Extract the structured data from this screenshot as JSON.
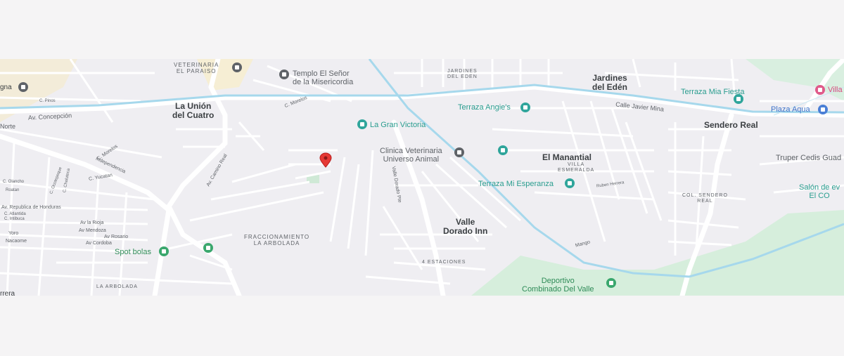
{
  "map": {
    "places": {
      "la_union": "La Unión\ndel Cuatro",
      "jardines": "Jardines\ndel Edén",
      "sendero": "Sendero Real",
      "manantial": "El Manantial",
      "valle": "Valle\nDorado Inn"
    },
    "neighborhoods": {
      "veterinaria_paraiso": "VETERINARIA\nEL PARAISO",
      "jardines_small": "JARDINES\nDEL EDEN",
      "villa_esmeralda": "VILLA\nESMERALDA",
      "col_sendero": "COL. SENDERO\nREAL",
      "fraccionamiento": "FRACCIONAMIENTO\nLA ARBOLADA",
      "cuatro_estaciones": "4 ESTACIONES",
      "la_arbolada": "LA ARBOLADA"
    },
    "streets": {
      "av_concepcion": "Av. Concepción",
      "norte": "Norte",
      "calle_javier_mina": "Calle Javier Mina",
      "c_morelos": "C. Morelos",
      "c_morelos2": "C. Morelos",
      "independencia": "Independencia",
      "av_camino_real": "Av. Camino Real",
      "c_yucatan": "C. Yucatan",
      "av_republica": "Av. Republica de Honduras",
      "av_la_rioja": "Av la Rioja",
      "av_mendoza": "Av Mendoza",
      "av_rosario": "Av Rosario",
      "av_cordoba": "Av Cordoba",
      "yoro": "Yoro",
      "nacaome": "Nacaome",
      "c_intibuca": "C. Intibuca",
      "c_atlantida": "C. Atlantida",
      "c_ocotepeque": "C. Ocotepeque",
      "c_choluteca": "C. Choluteca",
      "roatan": "Roatan",
      "c_olancho": "C. Olancho",
      "valle_dorado_pte": "Valle Dorado Pte",
      "mango": "Mango",
      "ruben_herrera": "Ruben Herrera",
      "c_pinos": "C. Pinos",
      "gna": "gna",
      "rrera": "rrera"
    },
    "pois": {
      "templo": "Templo El Señor\nde la Misericordia",
      "gran_victoria": "La Gran Victoria",
      "terraza_angie": "Terraza Angie's",
      "terraza_mia": "Terraza Mia Fiesta",
      "plaza_aqua": "Plaza Aqua",
      "villa": "Villa",
      "clinica": "Clinica Veterinaria\nUniverso Animal",
      "terraza_esperanza": "Terraza Mi Esperanza",
      "truper": "Truper Cedis Guad",
      "salon": "Salón de ev\nEl CO",
      "spot_bolas": "Spot bolas",
      "deportivo": "Deportivo\nCombinado Del Valle"
    },
    "colors": {
      "background": "#efeef2",
      "road": "#ffffff",
      "water_rail": "#8fd0e8",
      "park": "#d9efe0",
      "marker": "#e53935"
    }
  }
}
